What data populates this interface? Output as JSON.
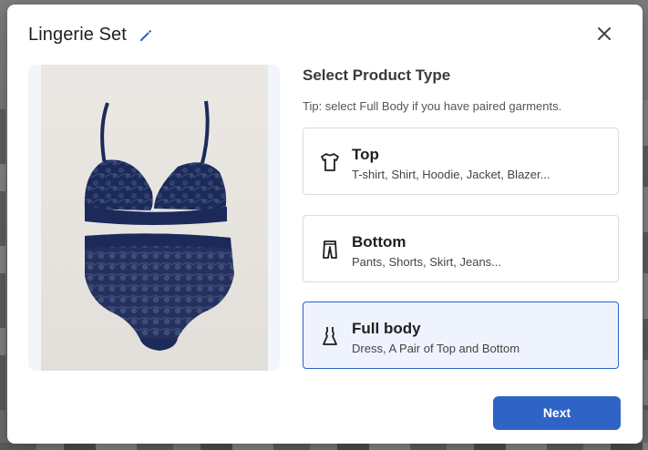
{
  "dialog": {
    "title": "Lingerie Set",
    "close_icon": "close-icon",
    "edit_icon": "pencil-icon"
  },
  "product_image": {
    "subject": "lingerie-set-photo"
  },
  "selector": {
    "heading": "Select Product Type",
    "tip": "Tip: select Full Body if you have paired garments.",
    "selected": "full_body",
    "options": [
      {
        "id": "top",
        "label": "Top",
        "description": "T-shirt, Shirt, Hoodie, Jacket, Blazer...",
        "icon": "tshirt-icon"
      },
      {
        "id": "bottom",
        "label": "Bottom",
        "description": "Pants, Shorts, Skirt, Jeans...",
        "icon": "pants-icon"
      },
      {
        "id": "full_body",
        "label": "Full body",
        "description": "Dress, A Pair of Top and Bottom",
        "icon": "dress-icon"
      }
    ]
  },
  "footer": {
    "next_label": "Next"
  },
  "colors": {
    "accent": "#2f64c6",
    "selected_bg": "#eef3fd",
    "border": "#dcdcdc",
    "garment": "#1c2a5a"
  }
}
